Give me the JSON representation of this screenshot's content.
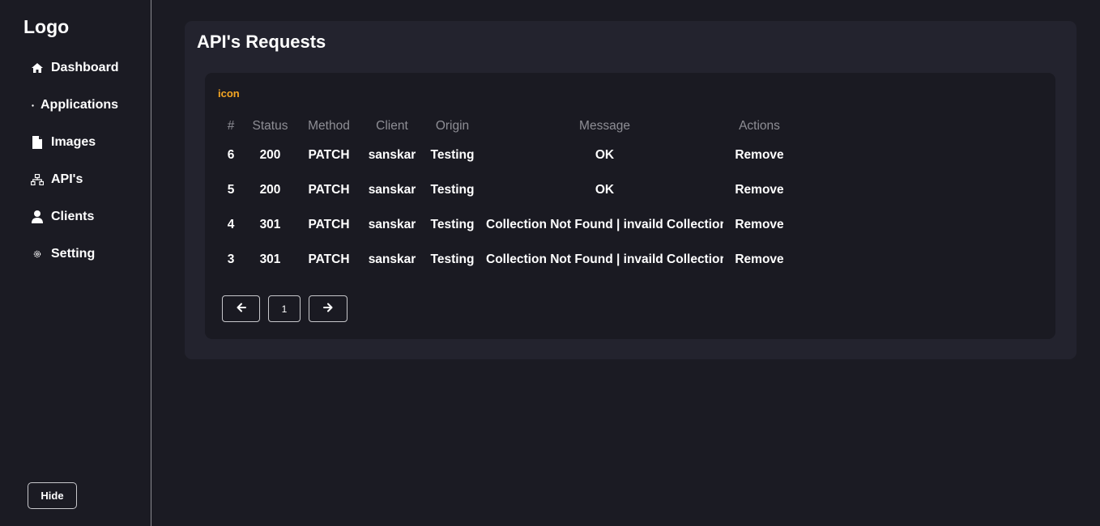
{
  "sidebar": {
    "logo": "Logo",
    "items": [
      {
        "label": "Dashboard",
        "icon": "home-icon"
      },
      {
        "label": "Applications",
        "icon": "dot-icon"
      },
      {
        "label": "Images",
        "icon": "file-icon"
      },
      {
        "label": "API's",
        "icon": "network-icon"
      },
      {
        "label": "Clients",
        "icon": "user-icon"
      },
      {
        "label": "Setting",
        "icon": "gear-icon"
      }
    ],
    "hide_label": "Hide"
  },
  "main": {
    "title": "API's Requests",
    "icon_label": "icon",
    "table": {
      "headers": [
        "#",
        "Status",
        "Method",
        "Client",
        "Origin",
        "Message",
        "Actions"
      ],
      "rows": [
        {
          "id": "6",
          "status": "200",
          "method": "PATCH",
          "client": "sanskar",
          "origin": "Testing",
          "message": "OK",
          "action": "Remove"
        },
        {
          "id": "5",
          "status": "200",
          "method": "PATCH",
          "client": "sanskar",
          "origin": "Testing",
          "message": "OK",
          "action": "Remove"
        },
        {
          "id": "4",
          "status": "301",
          "method": "PATCH",
          "client": "sanskar",
          "origin": "Testing",
          "message": "Collection Not Found | invaild Collectior",
          "action": "Remove"
        },
        {
          "id": "3",
          "status": "301",
          "method": "PATCH",
          "client": "sanskar",
          "origin": "Testing",
          "message": "Collection Not Found | invaild Collectior",
          "action": "Remove"
        }
      ]
    },
    "pagination": {
      "current_page": "1",
      "prev_icon": "arrow-left-icon",
      "next_icon": "arrow-right-icon"
    }
  },
  "colors": {
    "background": "#1b1b23",
    "card": "#23232e",
    "inner_card": "#1a1a22",
    "accent": "#f5a623",
    "header_text": "#8e8e95"
  }
}
